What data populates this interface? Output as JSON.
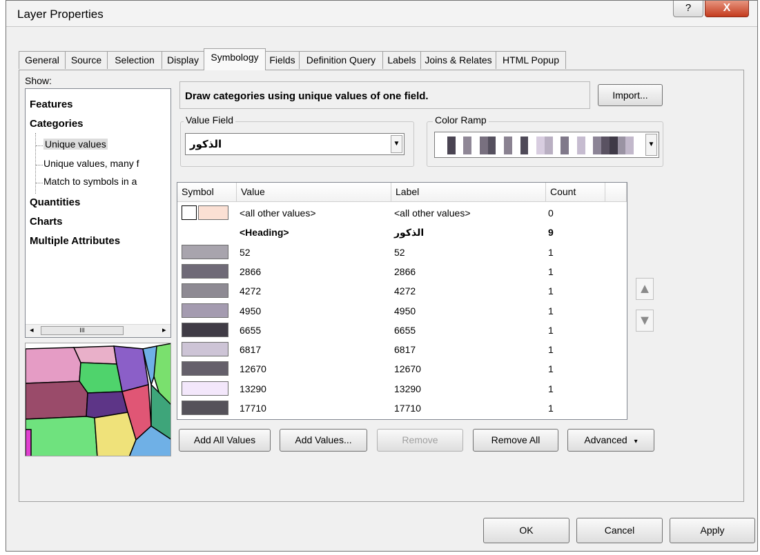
{
  "window": {
    "title": "Layer Properties",
    "help": "?",
    "close": "X"
  },
  "tabs": [
    {
      "label": "General"
    },
    {
      "label": "Source"
    },
    {
      "label": "Selection"
    },
    {
      "label": "Display"
    },
    {
      "label": "Symbology",
      "active": true
    },
    {
      "label": "Fields"
    },
    {
      "label": "Definition Query"
    },
    {
      "label": "Labels"
    },
    {
      "label": "Joins & Relates"
    },
    {
      "label": "HTML Popup"
    }
  ],
  "show": {
    "label": "Show:",
    "items": {
      "features": "Features",
      "categories": "Categories",
      "unique_values": "Unique values",
      "unique_values_many": "Unique values, many f",
      "match_symbols": "Match to symbols in a",
      "quantities": "Quantities",
      "charts": "Charts",
      "multiple_attributes": "Multiple Attributes"
    },
    "scroll_thumb": "III"
  },
  "description": "Draw categories using unique values of one field.",
  "import_label": "Import...",
  "value_field": {
    "label": "Value Field",
    "value": "الذكور"
  },
  "color_ramp": {
    "label": "Color Ramp",
    "colors": [
      "#ffffff",
      "#4a4452",
      "#ffffff",
      "#8f8796",
      "#ffffff",
      "#78707f",
      "#55505e",
      "#ffffff",
      "#8a8291",
      "#ffffff",
      "#4f4a58",
      "#ffffff",
      "#d8cde0",
      "#b9afc2",
      "#ffffff",
      "#80798a",
      "#ffffff",
      "#c6bcd0",
      "#ffffff",
      "#8c8496",
      "#5a5262",
      "#3f3a47",
      "#9a93a3",
      "#c2b8cb",
      "#ffffff"
    ]
  },
  "table": {
    "headers": {
      "symbol": "Symbol",
      "value": "Value",
      "label": "Label",
      "count": "Count"
    },
    "rows": [
      {
        "value": "<all other values>",
        "label": "<all other values>",
        "count": "0",
        "color": "#fbe0d4",
        "type": "other"
      },
      {
        "value": "<Heading>",
        "label": "الذكور",
        "count": "9",
        "type": "heading"
      },
      {
        "value": "52",
        "label": "52",
        "count": "1",
        "color": "#a8a4ad"
      },
      {
        "value": "2866",
        "label": "2866",
        "count": "1",
        "color": "#6f6a77"
      },
      {
        "value": "4272",
        "label": "4272",
        "count": "1",
        "color": "#8e8a93"
      },
      {
        "value": "4950",
        "label": "4950",
        "count": "1",
        "color": "#a49bb0"
      },
      {
        "value": "6655",
        "label": "6655",
        "count": "1",
        "color": "#403c46"
      },
      {
        "value": "6817",
        "label": "6817",
        "count": "1",
        "color": "#cdc4d6"
      },
      {
        "value": "12670",
        "label": "12670",
        "count": "1",
        "color": "#65606b"
      },
      {
        "value": "13290",
        "label": "13290",
        "count": "1",
        "color": "#f3e7fb"
      },
      {
        "value": "17710",
        "label": "17710",
        "count": "1",
        "color": "#55525a"
      }
    ]
  },
  "buttons": {
    "add_all_values": "Add All Values",
    "add_values": "Add Values...",
    "remove": "Remove",
    "remove_all": "Remove All",
    "advanced": "Advanced",
    "ok": "OK",
    "cancel": "Cancel",
    "apply": "Apply"
  },
  "icons": {
    "move_up": "arrow-up-icon",
    "move_down": "arrow-down-icon"
  }
}
